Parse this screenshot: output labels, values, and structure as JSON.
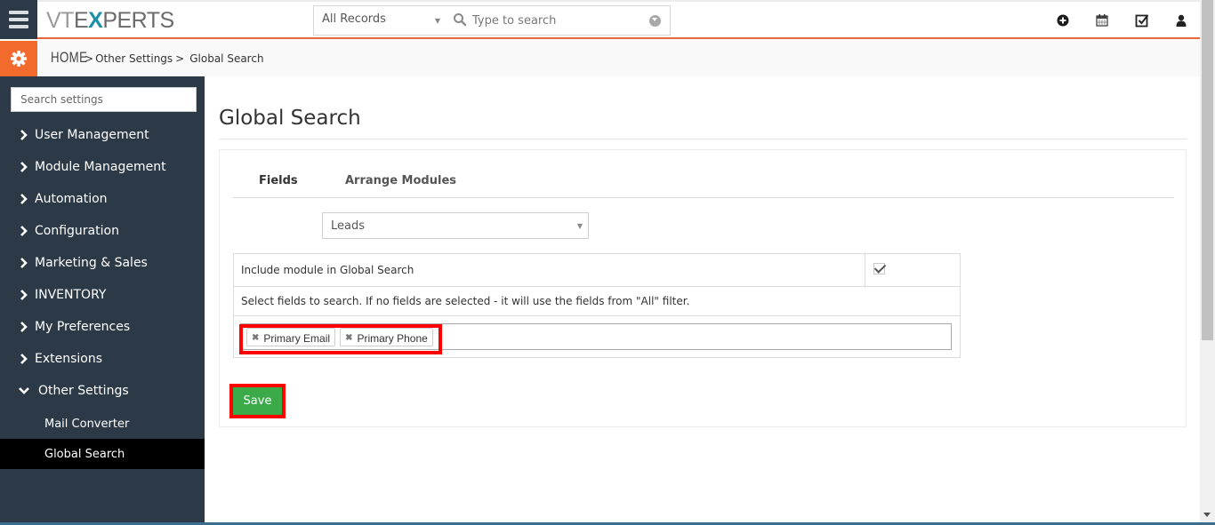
{
  "header": {
    "logo": {
      "part1": "VT",
      "part2": "E",
      "part3": "X",
      "part4": "PERTS"
    },
    "records_select": {
      "value": "All Records"
    },
    "search": {
      "placeholder": "Type to search"
    },
    "icons": [
      "add-icon",
      "calendar-icon",
      "task-icon",
      "user-icon"
    ]
  },
  "breadcrumb": {
    "home": "HOME",
    "items": [
      "Other Settings",
      "Global Search"
    ],
    "separator": ">"
  },
  "sidebar": {
    "search_placeholder": "Search settings",
    "items": [
      {
        "label": "User Management",
        "expanded": false
      },
      {
        "label": "Module Management",
        "expanded": false
      },
      {
        "label": "Automation",
        "expanded": false
      },
      {
        "label": "Configuration",
        "expanded": false
      },
      {
        "label": "Marketing & Sales",
        "expanded": false
      },
      {
        "label": "INVENTORY",
        "expanded": false
      },
      {
        "label": "My Preferences",
        "expanded": false
      },
      {
        "label": "Extensions",
        "expanded": false
      },
      {
        "label": "Other Settings",
        "expanded": true
      }
    ],
    "sub_items": [
      {
        "label": "Mail Converter",
        "active": false
      },
      {
        "label": "Global Search",
        "active": true
      }
    ]
  },
  "main": {
    "title": "Global Search",
    "tabs": [
      {
        "label": "Fields",
        "active": true
      },
      {
        "label": "Arrange Modules",
        "active": false
      }
    ],
    "module_select": {
      "value": "Leads"
    },
    "include_label": "Include module in Global Search",
    "include_checked": true,
    "fields_hint": "Select fields to search. If no fields are selected - it will use the fields from \"All\" filter.",
    "selected_fields": [
      "Primary Email",
      "Primary Phone"
    ],
    "remove_glyph": "✖",
    "save_label": "Save"
  },
  "colors": {
    "accent": "#f26a2c",
    "sidebar_bg": "#2c3a48",
    "save_green": "#3bab4a",
    "highlight_red": "#ff0000"
  }
}
